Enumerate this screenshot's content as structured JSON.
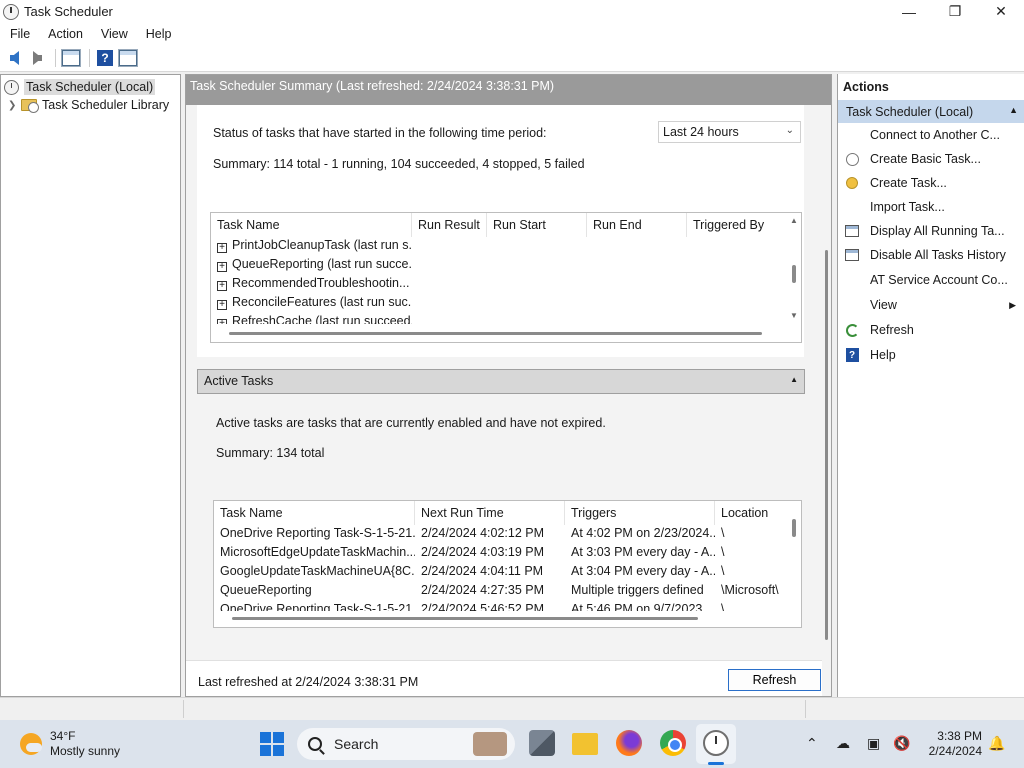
{
  "window": {
    "title": "Task Scheduler",
    "controls": {
      "minimize": "—",
      "maximize": "❐",
      "close": "✕"
    }
  },
  "menu": [
    "File",
    "Action",
    "View",
    "Help"
  ],
  "tree": {
    "root": "Task Scheduler (Local)",
    "library": "Task Scheduler Library"
  },
  "center": {
    "header": "Task Scheduler Summary (Last refreshed: 2/24/2024 3:38:31 PM)",
    "status_label": "Status of tasks that have started in the following time period:",
    "period": "Last 24 hours",
    "summary": "Summary: 114 total - 1 running, 104 succeeded, 4 stopped, 5 failed",
    "status_grid": {
      "columns": [
        "Task Name",
        "Run Result",
        "Run Start",
        "Run End",
        "Triggered By"
      ],
      "rows": [
        "PrintJobCleanupTask (last run s...",
        "QueueReporting (last run succe...",
        "RecommendedTroubleshootin...",
        "ReconcileFeatures (last run suc...",
        "RefreshCache (last run succeed..."
      ]
    },
    "active_tasks": {
      "header": "Active Tasks",
      "description": "Active tasks are tasks that are currently enabled and have not expired.",
      "summary": "Summary: 134 total",
      "columns": [
        "Task Name",
        "Next Run Time",
        "Triggers",
        "Location"
      ],
      "rows": [
        [
          "OneDrive Reporting Task-S-1-5-21...",
          "2/24/2024 4:02:12 PM",
          "At 4:02 PM on 2/23/2024...",
          "\\"
        ],
        [
          "MicrosoftEdgeUpdateTaskMachin...",
          "2/24/2024 4:03:19 PM",
          "At 3:03 PM every day - A...",
          "\\"
        ],
        [
          "GoogleUpdateTaskMachineUA{8C...",
          "2/24/2024 4:04:11 PM",
          "At 3:04 PM every day - A...",
          "\\"
        ],
        [
          "QueueReporting",
          "2/24/2024 4:27:35 PM",
          "Multiple triggers defined",
          "\\Microsoft\\"
        ],
        [
          "OneDrive Reporting Task-S-1-5-21...",
          "2/24/2024 5:46:52 PM",
          "At 5:46 PM on 9/7/2023...",
          "\\"
        ]
      ]
    },
    "last_refreshed": "Last refreshed at 2/24/2024 3:38:31 PM",
    "refresh_button": "Refresh"
  },
  "actions": {
    "title": "Actions",
    "group": "Task Scheduler (Local)",
    "items": [
      {
        "label": "Connect to Another C...",
        "icon": "none"
      },
      {
        "label": "Create Basic Task...",
        "icon": "wizard-icon"
      },
      {
        "label": "Create Task...",
        "icon": "task-icon"
      },
      {
        "label": "Import Task...",
        "icon": "none"
      },
      {
        "label": "Display All Running Ta...",
        "icon": "list-icon"
      },
      {
        "label": "Disable All Tasks History",
        "icon": "list-icon"
      },
      {
        "label": "AT Service Account Co...",
        "icon": "none"
      },
      {
        "label": "View",
        "icon": "none"
      },
      {
        "label": "Refresh",
        "icon": "refresh-icon"
      },
      {
        "label": "Help",
        "icon": "help-icon"
      }
    ]
  },
  "taskbar": {
    "weather_temp": "34°F",
    "weather_desc": "Mostly sunny",
    "search": "Search",
    "time": "3:38 PM",
    "date": "2/24/2024"
  },
  "colors": {
    "accent": "#1a73d8",
    "header_gray": "#9a9a9a",
    "actions_group": "#c5d7ec"
  }
}
